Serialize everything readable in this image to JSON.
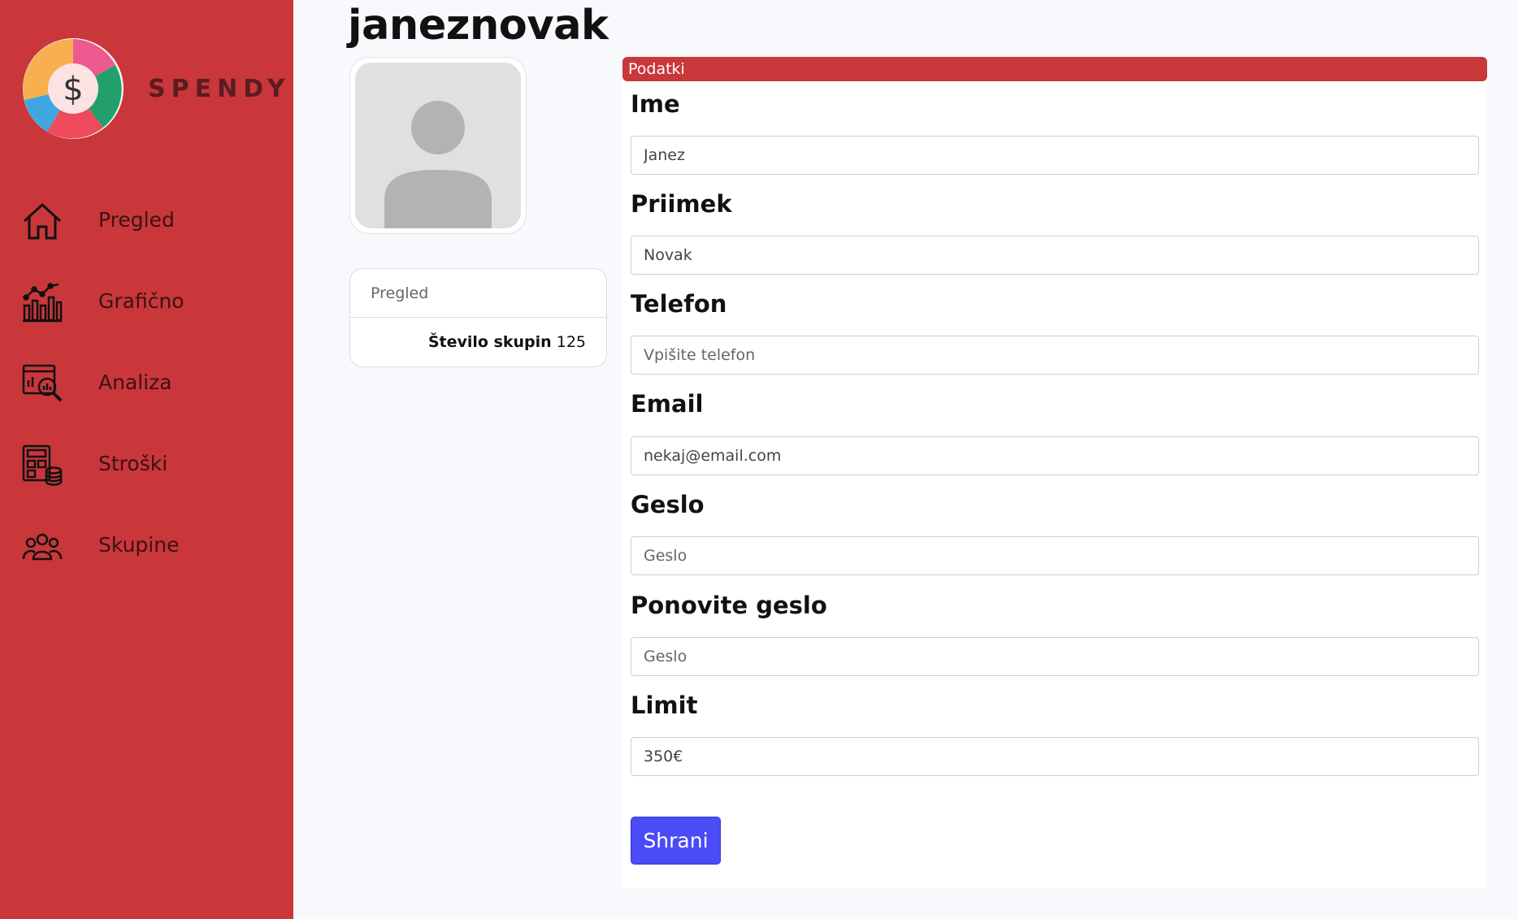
{
  "app": {
    "brand": "SPENDY"
  },
  "sidebar": {
    "items": [
      {
        "label": "Pregled",
        "icon": "home-icon"
      },
      {
        "label": "Grafično",
        "icon": "bar-chart-icon"
      },
      {
        "label": "Analiza",
        "icon": "analysis-icon"
      },
      {
        "label": "Stroški",
        "icon": "calculator-coins-icon"
      },
      {
        "label": "Skupine",
        "icon": "group-icon"
      }
    ]
  },
  "profile": {
    "username": "janeznovak"
  },
  "stats": {
    "header": "Pregled",
    "groups_label": "Število skupin",
    "groups_value": "125"
  },
  "form": {
    "title": "Podatki",
    "fields": [
      {
        "label": "Ime",
        "value": "Janez",
        "placeholder": ""
      },
      {
        "label": "Priimek",
        "value": "Novak",
        "placeholder": ""
      },
      {
        "label": "Telefon",
        "value": "",
        "placeholder": "Vpišite telefon"
      },
      {
        "label": "Email",
        "value": "nekaj@email.com",
        "placeholder": ""
      },
      {
        "label": "Geslo",
        "value": "",
        "placeholder": "Geslo"
      },
      {
        "label": "Ponovite geslo",
        "value": "",
        "placeholder": "Geslo"
      },
      {
        "label": "Limit",
        "value": "350€",
        "placeholder": ""
      }
    ],
    "save_label": "Shrani"
  },
  "colors": {
    "sidebar_bg": "#c9373a",
    "header_bg": "#c9373a",
    "button_bg": "#4a4cf5",
    "page_bg": "#f8f9fc"
  }
}
